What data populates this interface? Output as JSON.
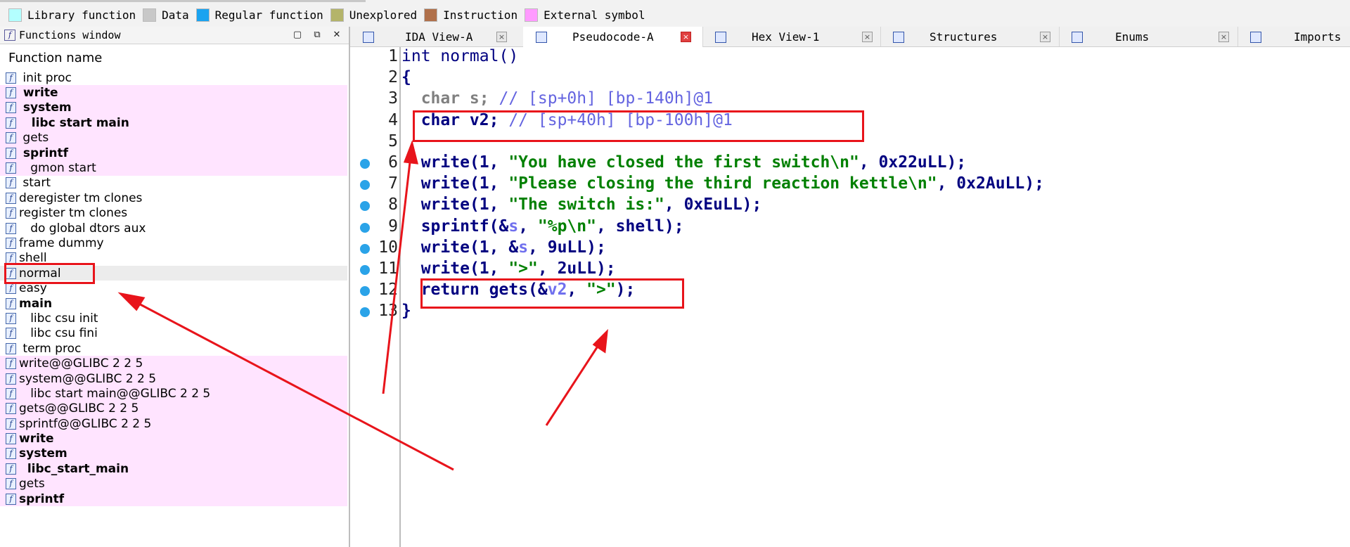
{
  "legend": [
    {
      "label": "Library function",
      "color": "#b3ffff"
    },
    {
      "label": "Data",
      "color": "#c8c8c8"
    },
    {
      "label": "Regular function",
      "color": "#1aa3f0"
    },
    {
      "label": "Unexplored",
      "color": "#b4b46a"
    },
    {
      "label": "Instruction",
      "color": "#b0704a"
    },
    {
      "label": "External symbol",
      "color": "#ff9aff"
    }
  ],
  "functions_window": {
    "title": "Functions window",
    "column_header": "Function name",
    "items": [
      {
        "name": " init proc",
        "style": "normal",
        "bold": false
      },
      {
        "name": " write",
        "style": "pink",
        "bold": true
      },
      {
        "name": " system",
        "style": "pink",
        "bold": true
      },
      {
        "name": "   libc start main",
        "style": "pink",
        "bold": true
      },
      {
        "name": " gets",
        "style": "pink",
        "bold": false
      },
      {
        "name": " sprintf",
        "style": "pink",
        "bold": true
      },
      {
        "name": "   gmon start",
        "style": "pink",
        "bold": false
      },
      {
        "name": " start",
        "style": "normal",
        "bold": false
      },
      {
        "name": "deregister tm clones",
        "style": "normal",
        "bold": false
      },
      {
        "name": "register tm clones",
        "style": "normal",
        "bold": false
      },
      {
        "name": "   do global dtors aux",
        "style": "normal",
        "bold": false
      },
      {
        "name": "frame dummy",
        "style": "normal",
        "bold": false
      },
      {
        "name": "shell",
        "style": "normal",
        "bold": false
      },
      {
        "name": "normal",
        "style": "gray",
        "bold": false
      },
      {
        "name": "easy",
        "style": "normal",
        "bold": false
      },
      {
        "name": "main",
        "style": "normal",
        "bold": true
      },
      {
        "name": "   libc csu init",
        "style": "normal",
        "bold": false
      },
      {
        "name": "   libc csu fini",
        "style": "normal",
        "bold": false
      },
      {
        "name": " term proc",
        "style": "normal",
        "bold": false
      },
      {
        "name": "write@@GLIBC 2 2 5",
        "style": "pink",
        "bold": false
      },
      {
        "name": "system@@GLIBC 2 2 5",
        "style": "pink",
        "bold": false
      },
      {
        "name": "   libc start main@@GLIBC 2 2 5",
        "style": "pink",
        "bold": false
      },
      {
        "name": "gets@@GLIBC 2 2 5",
        "style": "pink",
        "bold": false
      },
      {
        "name": "sprintf@@GLIBC 2 2 5",
        "style": "pink",
        "bold": false
      },
      {
        "name": "write",
        "style": "pink",
        "bold": true
      },
      {
        "name": "system",
        "style": "pink",
        "bold": true
      },
      {
        "name": "  libc_start_main",
        "style": "pink",
        "bold": true
      },
      {
        "name": "gets",
        "style": "pink",
        "bold": false
      },
      {
        "name": "sprintf",
        "style": "pink",
        "bold": true
      }
    ]
  },
  "tabs": [
    {
      "label": "IDA View-A",
      "active": false
    },
    {
      "label": "Pseudocode-A",
      "active": true
    },
    {
      "label": "Hex View-1",
      "active": false
    },
    {
      "label": "Structures",
      "active": false
    },
    {
      "label": "Enums",
      "active": false
    },
    {
      "label": "Imports",
      "active": false
    }
  ],
  "pseudocode": {
    "lines": [
      {
        "num": "1",
        "breakpoint": false,
        "tokens": [
          [
            "int normal()",
            "plain"
          ]
        ]
      },
      {
        "num": "2",
        "breakpoint": false,
        "tokens": [
          [
            "{",
            "p"
          ]
        ]
      },
      {
        "num": "3",
        "breakpoint": false,
        "tokens": [
          [
            "  char s; ",
            "g"
          ],
          [
            "// [sp+0h] [bp-140h]@1",
            "c"
          ]
        ]
      },
      {
        "num": "4",
        "breakpoint": false,
        "tokens": [
          [
            "  char v2; ",
            "k"
          ],
          [
            "// [sp+40h] [bp-100h]@1",
            "c"
          ]
        ]
      },
      {
        "num": "5",
        "breakpoint": false,
        "tokens": [
          [
            "",
            "p"
          ]
        ]
      },
      {
        "num": "6",
        "breakpoint": true,
        "tokens": [
          [
            "  write",
            "k"
          ],
          [
            "(1, ",
            "n"
          ],
          [
            "\"You have closed the first switch\\n\"",
            "s"
          ],
          [
            ", 0x22uLL);",
            "n"
          ]
        ]
      },
      {
        "num": "7",
        "breakpoint": true,
        "tokens": [
          [
            "  write",
            "k"
          ],
          [
            "(1, ",
            "n"
          ],
          [
            "\"Please closing the third reaction kettle\\n\"",
            "s"
          ],
          [
            ", 0x2AuLL);",
            "n"
          ]
        ]
      },
      {
        "num": "8",
        "breakpoint": true,
        "tokens": [
          [
            "  write",
            "k"
          ],
          [
            "(1, ",
            "n"
          ],
          [
            "\"The switch is:\"",
            "s"
          ],
          [
            ", 0xEuLL);",
            "n"
          ]
        ]
      },
      {
        "num": "9",
        "breakpoint": true,
        "tokens": [
          [
            "  sprintf",
            "k"
          ],
          [
            "(&",
            "n"
          ],
          [
            "s",
            "v"
          ],
          [
            ", ",
            "n"
          ],
          [
            "\"%p\\n\"",
            "s"
          ],
          [
            ", shell);",
            "n"
          ]
        ]
      },
      {
        "num": "10",
        "breakpoint": true,
        "tokens": [
          [
            "  write",
            "k"
          ],
          [
            "(1, &",
            "n"
          ],
          [
            "s",
            "v"
          ],
          [
            ", 9uLL);",
            "n"
          ]
        ]
      },
      {
        "num": "11",
        "breakpoint": true,
        "tokens": [
          [
            "  write",
            "k"
          ],
          [
            "(1, ",
            "n"
          ],
          [
            "\">\"",
            "s"
          ],
          [
            ", 2uLL);",
            "n"
          ]
        ]
      },
      {
        "num": "12",
        "breakpoint": true,
        "tokens": [
          [
            "  return gets",
            "k"
          ],
          [
            "(&",
            "n"
          ],
          [
            "v2",
            "v"
          ],
          [
            ", ",
            "n"
          ],
          [
            "\">\"",
            "s"
          ],
          [
            ");",
            "n"
          ]
        ]
      },
      {
        "num": "13",
        "breakpoint": true,
        "tokens": [
          [
            "}",
            "p"
          ]
        ]
      }
    ]
  },
  "colors": {
    "highlight": "#e8141b",
    "pink_row": "#ffe4ff",
    "breakpoint": "#2aa3e8"
  }
}
